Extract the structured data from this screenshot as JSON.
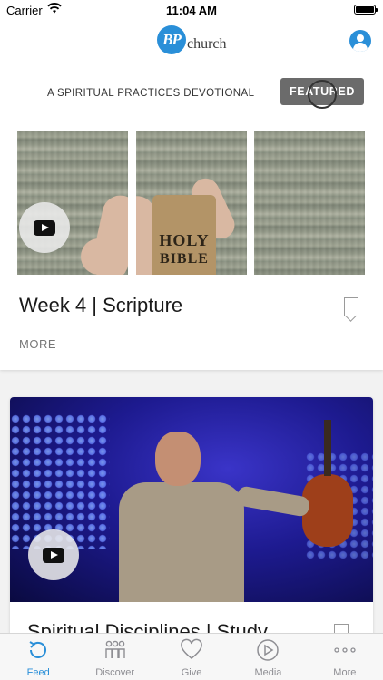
{
  "status_bar": {
    "carrier": "Carrier",
    "time": "11:04 AM"
  },
  "header": {
    "logo_mark": "BP",
    "logo_text": "church",
    "profile_icon": "person-circle-icon"
  },
  "feed": {
    "featured_card": {
      "devotional_title": "A SPIRITUAL PRACTICES DEVOTIONAL",
      "badge": "FEATURED",
      "bible_text_line1": "HOLY",
      "bible_text_line2": "BIBLE",
      "title": "Week 4 | Scripture",
      "more_label": "MORE"
    },
    "second_card": {
      "title": "Spiritual Disciplines | Study"
    }
  },
  "tab_bar": {
    "items": [
      {
        "label": "Feed",
        "icon": "refresh-icon",
        "active": true
      },
      {
        "label": "Discover",
        "icon": "people-icon",
        "active": false
      },
      {
        "label": "Give",
        "icon": "heart-icon",
        "active": false
      },
      {
        "label": "Media",
        "icon": "play-circle-icon",
        "active": false
      },
      {
        "label": "More",
        "icon": "ellipsis-icon",
        "active": false
      }
    ]
  },
  "colors": {
    "accent": "#2a8fd8",
    "badge_bg": "#6b6b6b",
    "inactive_tab": "#8e8e93"
  }
}
